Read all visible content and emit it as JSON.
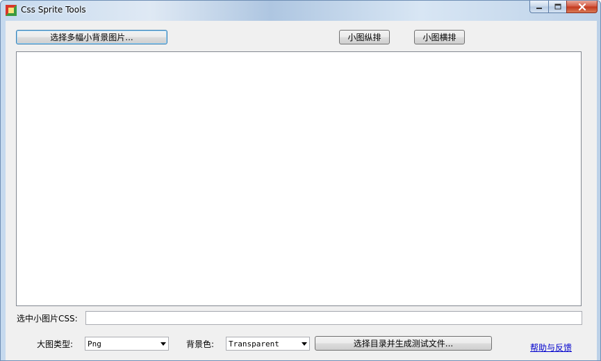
{
  "window": {
    "title": "Css Sprite Tools"
  },
  "toolbar": {
    "select_images_label": "选择多幅小背景图片...",
    "vertical_layout_label": "小图纵排",
    "horizontal_layout_label": "小图横排"
  },
  "selected_css": {
    "label": "选中小图片CSS:",
    "value": ""
  },
  "footer": {
    "image_type_label": "大图类型:",
    "image_type_value": "Png",
    "bg_color_label": "背景色:",
    "bg_color_value": "Transparent",
    "generate_label": "选择目录并生成测试文件...",
    "help_link": "帮助与反馈"
  },
  "icons": {
    "app": "app-icon",
    "minimize": "minimize-icon",
    "maximize": "maximize-icon",
    "close": "close-icon",
    "dropdown": "chevron-down-icon"
  },
  "colors": {
    "link": "#0000cc",
    "client_bg": "#f0f0f0",
    "close_button": "#c1361d"
  }
}
